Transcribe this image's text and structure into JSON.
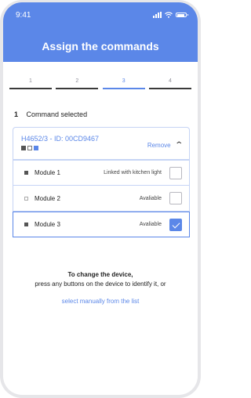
{
  "status": {
    "time": "9:41"
  },
  "header": {
    "title": "Assign the commands"
  },
  "steps": [
    {
      "label": "1"
    },
    {
      "label": "2"
    },
    {
      "label": "3"
    },
    {
      "label": "4"
    }
  ],
  "active_step": 3,
  "selection": {
    "count": "1",
    "label": "Command selected"
  },
  "device": {
    "id_text": "H4652/3 - ID: 00CD9467",
    "remove_label": "Remove"
  },
  "modules": [
    {
      "name": "Module 1",
      "status": "Linked with kitchen light",
      "checked": false
    },
    {
      "name": "Module 2",
      "status": "Avaliable",
      "checked": false
    },
    {
      "name": "Module 3",
      "status": "Avaliable",
      "checked": true
    }
  ],
  "help": {
    "title": "To change the device,",
    "body": "press any buttons on the device to identify it,  or",
    "link": "select manually from the list"
  },
  "colors": {
    "accent": "#5b87e8"
  }
}
